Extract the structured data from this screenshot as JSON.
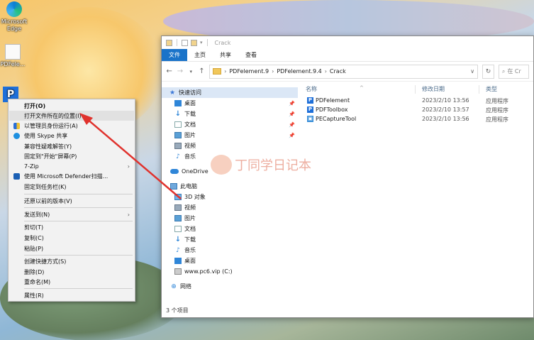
{
  "desktop": {
    "icons": [
      {
        "label": "Microsoft Edge",
        "icon": "edge-icon"
      },
      {
        "label": "PDFele...",
        "icon": "file-icon"
      },
      {
        "label": "PDFelement",
        "icon": "pdf-icon"
      }
    ]
  },
  "explorer": {
    "title": "Crack",
    "ribbon": [
      "文件",
      "主页",
      "共享",
      "查看"
    ],
    "breadcrumb": [
      "PDFelement.9",
      "PDFelement.9.4",
      "Crack"
    ],
    "search_placeholder": "在 Cr",
    "nav": [
      {
        "label": "快速访问",
        "icon": "star-icon",
        "selected": true
      },
      {
        "label": "桌面",
        "icon": "desktop-icon",
        "pinned": true
      },
      {
        "label": "下载",
        "icon": "download-icon",
        "pinned": true
      },
      {
        "label": "文档",
        "icon": "document-icon",
        "pinned": true
      },
      {
        "label": "图片",
        "icon": "picture-icon",
        "pinned": true
      },
      {
        "label": "视频",
        "icon": "video-icon"
      },
      {
        "label": "音乐",
        "icon": "music-icon"
      },
      {
        "label": "OneDrive",
        "icon": "onedrive-icon"
      },
      {
        "label": "此电脑",
        "icon": "pc-icon"
      },
      {
        "label": "3D 对象",
        "icon": "3d-objects-icon"
      },
      {
        "label": "视频",
        "icon": "video-icon"
      },
      {
        "label": "图片",
        "icon": "picture-icon"
      },
      {
        "label": "文档",
        "icon": "document-icon"
      },
      {
        "label": "下载",
        "icon": "download-icon"
      },
      {
        "label": "音乐",
        "icon": "music-icon"
      },
      {
        "label": "桌面",
        "icon": "desktop-icon"
      },
      {
        "label": "www.pc6.vip (C:)",
        "icon": "drive-icon"
      },
      {
        "label": "网络",
        "icon": "network-icon"
      }
    ],
    "columns": [
      "名称",
      "修改日期",
      "类型"
    ],
    "files": [
      {
        "name": "PDFelement",
        "date": "2023/2/10 13:56",
        "type": "应用程序"
      },
      {
        "name": "PDFToolbox",
        "date": "2023/2/10 13:57",
        "type": "应用程序"
      },
      {
        "name": "PECaptureTool",
        "date": "2023/2/10 13:56",
        "type": "应用程序"
      }
    ],
    "status": "3 个项目"
  },
  "watermark": "丁同学日记本",
  "context_menu": [
    {
      "label": "打开(O)",
      "bold": true
    },
    {
      "label": "打开文件所在的位置(I)",
      "highlighted": true
    },
    {
      "label": "以管理员身份运行(A)",
      "icon": "shield-icon"
    },
    {
      "label": "使用 Skype 共享",
      "icon": "skype-icon"
    },
    {
      "label": "兼容性疑难解答(Y)"
    },
    {
      "label": "固定到\"开始\"屏幕(P)"
    },
    {
      "label": "7-Zip",
      "submenu": true
    },
    {
      "label": "使用 Microsoft Defender扫描...",
      "icon": "defender-icon"
    },
    {
      "label": "固定到任务栏(K)"
    },
    {
      "label": "还原以前的版本(V)"
    },
    {
      "label": "发送到(N)",
      "submenu": true
    },
    {
      "label": "剪切(T)"
    },
    {
      "label": "复制(C)"
    },
    {
      "label": "粘贴(P)"
    },
    {
      "label": "创建快捷方式(S)"
    },
    {
      "label": "删除(D)"
    },
    {
      "label": "重命名(M)"
    },
    {
      "label": "属性(R)"
    }
  ],
  "colors": {
    "accent": "#1a73c9",
    "arrow": "#e0322d",
    "selection": "#dbe7f6"
  }
}
